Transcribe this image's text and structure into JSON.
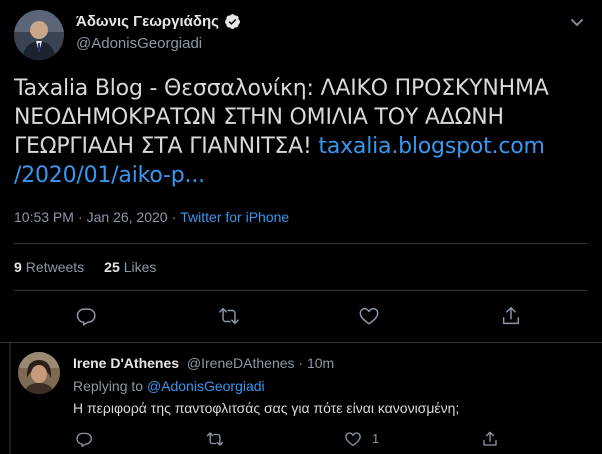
{
  "tweet": {
    "author_name": "Άδωνις Γεωργιάδης",
    "author_handle": "@AdonisGeorgiadi",
    "text_plain": "Taxalia Blog - Θεσσαλονίκη: ΛΑΙΚΟ ΠΡΟΣΚΥΝΗΜΑ ΝΕΟΔΗΜΟΚΡΑΤΩΝ ΣΤΗΝ ΟΜΙΛΙΑ ΤΟΥ ΑΔΩΝΗ ΓΕΩΡΓΙΑΔΗ ΣΤΑ ΓΙΑΝΝΙΤΣΑ!",
    "link_text_1": "taxalia.blogspot.com",
    "link_text_2": "/2020/01/aiko-p...",
    "time": "10:53 PM",
    "date": "Jan 26, 2020",
    "separator": "·",
    "source": "Twitter for iPhone",
    "retweets_count": "9",
    "retweets_label": "Retweets",
    "likes_count": "25",
    "likes_label": "Likes"
  },
  "icons": {
    "verified": "verified-badge-icon",
    "menu": "chevron-down-icon",
    "reply": "reply-icon",
    "retweet": "retweet-icon",
    "like": "heart-icon",
    "share": "share-icon"
  },
  "reply": {
    "name": "Irene D'Athenes",
    "handle": "@IreneDAthenes",
    "separator": "·",
    "time": "10m",
    "replying_label": "Replying to",
    "replying_mention": "@AdonisGeorgiadi",
    "text": "Η περιφορά της παντοφλιτσάς σας για πότε είναι κανονισμένη;",
    "like_count": "1"
  },
  "colors": {
    "background": "#000000",
    "text": "#d9d9d9",
    "muted": "#8b98a5",
    "link": "#3897f0",
    "divider": "#2f3336"
  }
}
